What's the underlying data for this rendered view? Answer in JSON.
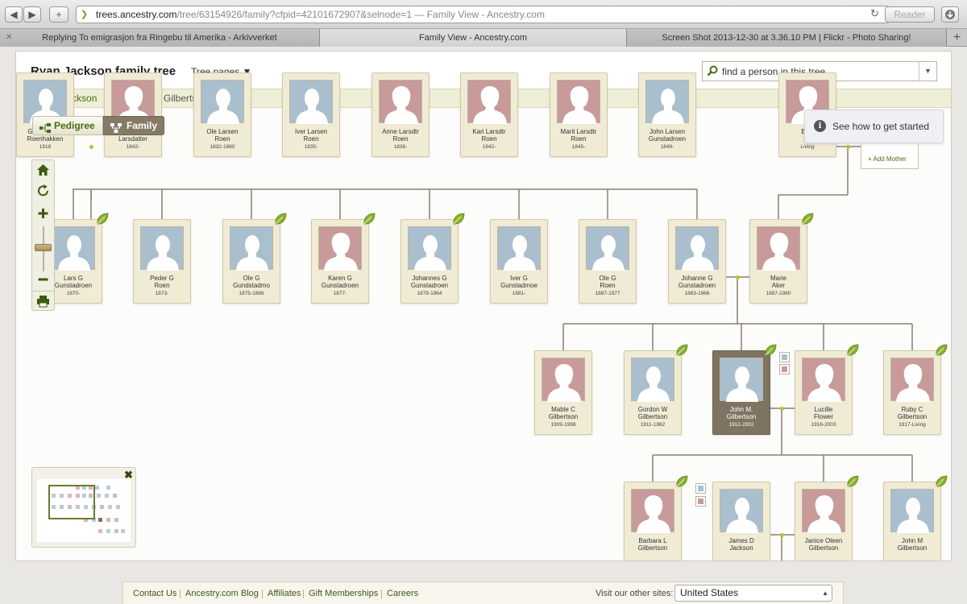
{
  "browser": {
    "url_domain": "trees.ancestry.com",
    "url_rest": "/tree/63154926/family?cfpid=42101672907&selnode=1 — Family View - Ancestry.com",
    "reader_label": "Reader",
    "back_label": "◀",
    "forward_label": "▶",
    "newtab_label": "+",
    "reload_label": "↻",
    "tabs": [
      {
        "label": "Replying To emigrasjon fra Ringebu til Amerika - Arkivverket",
        "active": false
      },
      {
        "label": "Family View - Ancestry.com",
        "active": true
      },
      {
        "label": "Screen Shot 2013-12-30 at 3.36.10 PM | Flickr - Photo Sharing!",
        "active": false
      }
    ],
    "tab_plus": "+"
  },
  "header": {
    "title": "Ryan Jackson family tree",
    "tree_pages_label": "Tree pages ▼",
    "search_placeholder": "find a person in this tree",
    "search_dropdown": "▼"
  },
  "breadcrumbs": [
    {
      "label": "Ryan Jackson"
    },
    {
      "label": "John M. Gilbertson"
    }
  ],
  "view_toggle": {
    "pedigree_label": "Pedigree",
    "family_label": "Family"
  },
  "help": {
    "icon_text": "i",
    "label": "See how to get started"
  },
  "tree": {
    "gen1": [
      {
        "name": "Gudbrand P\nRoenhakken",
        "dates": "1918",
        "sex": "m"
      },
      {
        "name": "Mari\nLarsdatter",
        "dates": "1842-",
        "sex": "f"
      },
      {
        "name": "Ole Larsen\nRoen",
        "dates": "1832-1860",
        "sex": "m"
      },
      {
        "name": "Iver Larsen\nRoen",
        "dates": "1835-",
        "sex": "m"
      },
      {
        "name": "Anne Larsdtr\nRoen",
        "dates": "1838-",
        "sex": "f"
      },
      {
        "name": "Kari Larsdtr\nRoen",
        "dates": "1842-",
        "sex": "f"
      },
      {
        "name": "Marit Larsdtr\nRoen",
        "dates": "1845-",
        "sex": "f"
      },
      {
        "name": "John Larsen\nGunstadroen",
        "dates": "1849-",
        "sex": "m"
      },
      {
        "name": "Elke",
        "dates": "Living",
        "sex": "f"
      }
    ],
    "add_mother_label": "+ Add Mother",
    "gen2": [
      {
        "name": "Lars G\nGunstadroen",
        "dates": "1870-",
        "sex": "m"
      },
      {
        "name": "Peder G\nRoen",
        "dates": "1873-",
        "sex": "m"
      },
      {
        "name": "Ole G\nGundstadmo",
        "dates": "1875-1886",
        "sex": "m"
      },
      {
        "name": "Karen G\nGunstadroen",
        "dates": "1877-",
        "sex": "f"
      },
      {
        "name": "Johannes G\nGunstadroen",
        "dates": "1879-1964",
        "sex": "m"
      },
      {
        "name": "Iver G\nGunstadmoe",
        "dates": "1881-",
        "sex": "m"
      },
      {
        "name": "Ole G\nRoen",
        "dates": "1887-1977",
        "sex": "m"
      },
      {
        "name": "Johanne G\nGunstadroen",
        "dates": "1883-1966",
        "sex": "m"
      },
      {
        "name": "Marie\nAker",
        "dates": "1887-1960",
        "sex": "f"
      }
    ],
    "gen3": [
      {
        "name": "Mable C\nGilbertson",
        "dates": "1909-1998",
        "sex": "f"
      },
      {
        "name": "Gordon W\nGilbertson",
        "dates": "1911-1962",
        "sex": "m"
      },
      {
        "name": "John M.\nGilbertson",
        "dates": "1912-2002",
        "sex": "m",
        "selected": true
      },
      {
        "name": "Lucille\nFlower",
        "dates": "1918-2003",
        "sex": "f"
      },
      {
        "name": "Ruby C\nGilbertson",
        "dates": "1917-Living",
        "sex": "f"
      }
    ],
    "gen4": [
      {
        "name": "Barbara L\nGilbertson",
        "dates": "",
        "sex": "f"
      },
      {
        "name": "James D\nJackson",
        "dates": "",
        "sex": "m"
      },
      {
        "name": "Janice Oleen\nGilbertson",
        "dates": "",
        "sex": "f"
      },
      {
        "name": "John M\nGilbertson",
        "dates": "",
        "sex": "m"
      }
    ]
  },
  "minimap": {
    "close_label": "✖"
  },
  "footer": {
    "links": [
      "Contact Us",
      "Ancestry.com Blog",
      "Affiliates",
      "Gift Memberships",
      "Careers"
    ],
    "visit_label": "Visit our other sites:",
    "site_selected": "United States"
  },
  "colors": {
    "male_photo": "#a9bfcd",
    "female_photo": "#c89a9a",
    "card_bg": "#f0ebd5",
    "selected_card": "#7f7461",
    "link_green": "#4a6b18"
  }
}
